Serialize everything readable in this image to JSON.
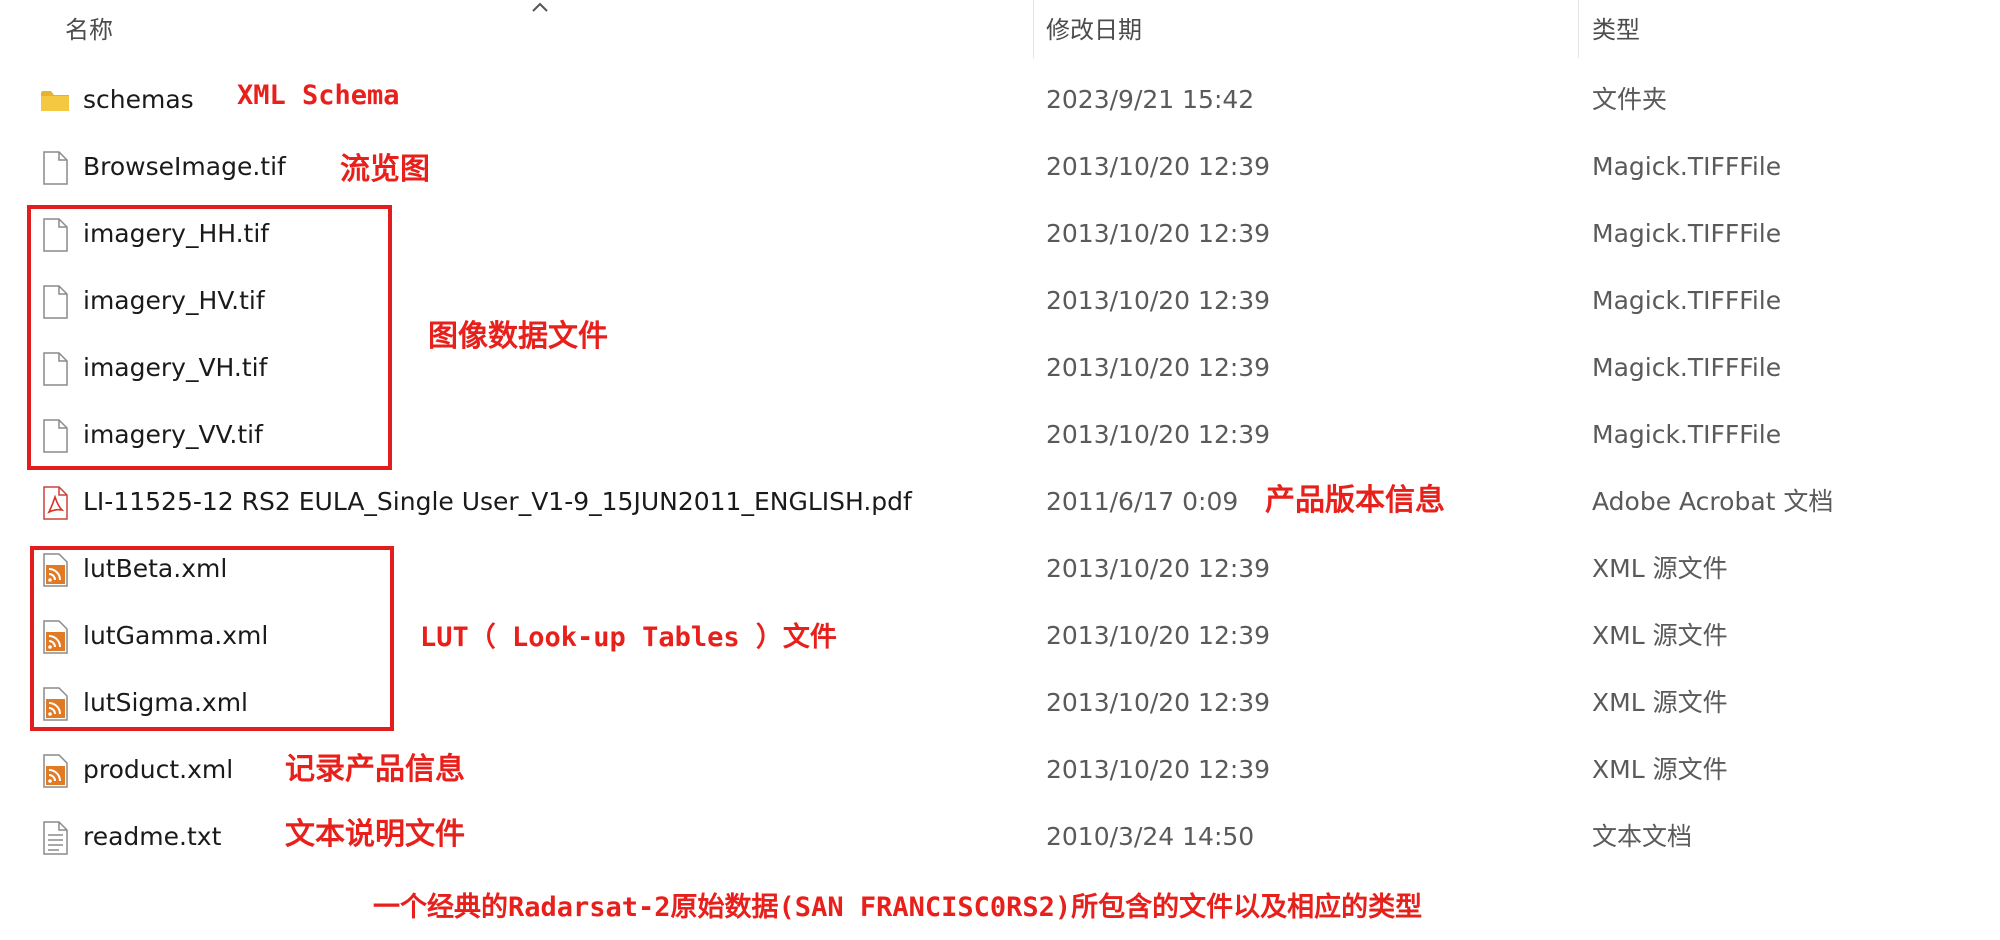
{
  "columns": {
    "name": "名称",
    "date": "修改日期",
    "type": "类型"
  },
  "files": [
    {
      "name": "schemas",
      "date": "2023/9/21 15:42",
      "type": "文件夹",
      "icon": "folder-icon"
    },
    {
      "name": "BrowseImage.tif",
      "date": "2013/10/20 12:39",
      "type": "Magick.TIFFFile",
      "icon": "file-icon"
    },
    {
      "name": "imagery_HH.tif",
      "date": "2013/10/20 12:39",
      "type": "Magick.TIFFFile",
      "icon": "file-icon"
    },
    {
      "name": "imagery_HV.tif",
      "date": "2013/10/20 12:39",
      "type": "Magick.TIFFFile",
      "icon": "file-icon"
    },
    {
      "name": "imagery_VH.tif",
      "date": "2013/10/20 12:39",
      "type": "Magick.TIFFFile",
      "icon": "file-icon"
    },
    {
      "name": "imagery_VV.tif",
      "date": "2013/10/20 12:39",
      "type": "Magick.TIFFFile",
      "icon": "file-icon"
    },
    {
      "name": "LI-11525-12 RS2 EULA_Single User_V1-9_15JUN2011_ENGLISH.pdf",
      "date": "2011/6/17 0:09",
      "type": "Adobe Acrobat 文档",
      "icon": "pdf-icon"
    },
    {
      "name": "lutBeta.xml",
      "date": "2013/10/20 12:39",
      "type": "XML 源文件",
      "icon": "xml-icon"
    },
    {
      "name": "lutGamma.xml",
      "date": "2013/10/20 12:39",
      "type": "XML 源文件",
      "icon": "xml-icon"
    },
    {
      "name": "lutSigma.xml",
      "date": "2013/10/20 12:39",
      "type": "XML 源文件",
      "icon": "xml-icon"
    },
    {
      "name": "product.xml",
      "date": "2013/10/20 12:39",
      "type": "XML 源文件",
      "icon": "xml-icon"
    },
    {
      "name": "readme.txt",
      "date": "2010/3/24 14:50",
      "type": "文本文档",
      "icon": "text-file-icon"
    }
  ],
  "annotations": {
    "schema": "XML Schema",
    "browse": "流览图",
    "imagery": "图像数据文件",
    "product_version": "产品版本信息",
    "lut": "LUT（ Look-up Tables ）文件",
    "product_record": "记录产品信息",
    "readme": "文本说明文件",
    "caption": "一个经典的Radarsat-2原始数据(SAN FRANCISC0RS2)所包含的文件以及相应的类型"
  },
  "colors": {
    "annotation": "#e8201c",
    "folder": "#f3c339",
    "xml_icon": "#e07a24",
    "pdf_icon": "#d9322b"
  }
}
